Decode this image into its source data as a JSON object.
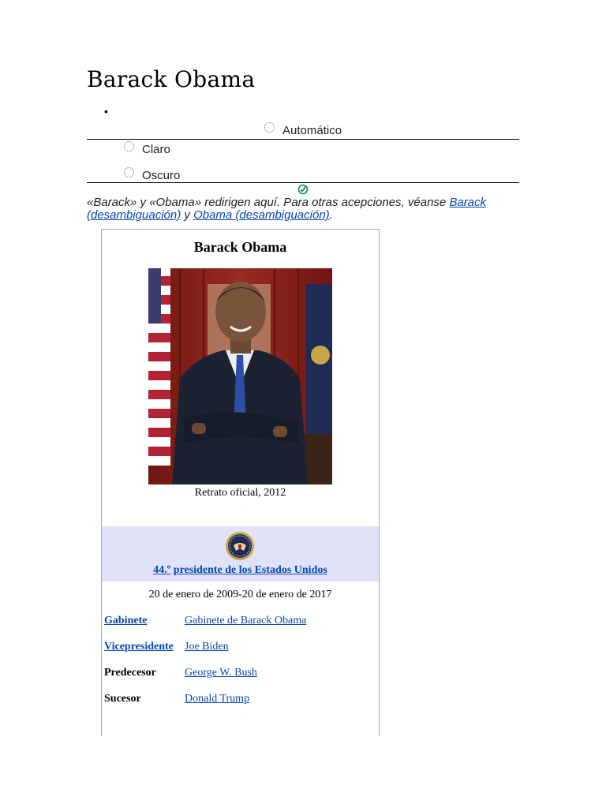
{
  "page": {
    "title": "Barack Obama"
  },
  "theme_switcher": {
    "bullet": "•",
    "options": [
      {
        "label": "Automático"
      },
      {
        "label": "Claro"
      },
      {
        "label": "Oscuro"
      }
    ],
    "icon": "check-circle-icon"
  },
  "hatnote": {
    "intro": "«Barack»  y «Obama» redirigen aquí. Para otras acepciones, véanse ",
    "link1": "Barack (desambiguación)",
    "between": " y ",
    "link2": "Obama (desambiguación)",
    "end": "."
  },
  "infobox": {
    "title": "Barack Obama",
    "image_caption": "Retrato oficial, 2012",
    "office": {
      "ordinal": "44.º",
      "name": "presidente de los Estados Unidos",
      "term": "20 de enero de 2009-20 de enero de 2017",
      "seal_icon": "presidential-seal-icon",
      "band_color": "#e0e3f7"
    },
    "rows": [
      {
        "label": "Gabinete",
        "value": "Gabinete de Barack Obama"
      },
      {
        "label": "Vicepresidente",
        "value": "Joe Biden"
      },
      {
        "label": "Predecesor",
        "value": "George W. Bush"
      },
      {
        "label": "Sucesor",
        "value": "Donald Trump"
      }
    ]
  },
  "colors": {
    "link": "#0645ad",
    "text": "#202122",
    "infobox_border": "#a2a9b1"
  }
}
